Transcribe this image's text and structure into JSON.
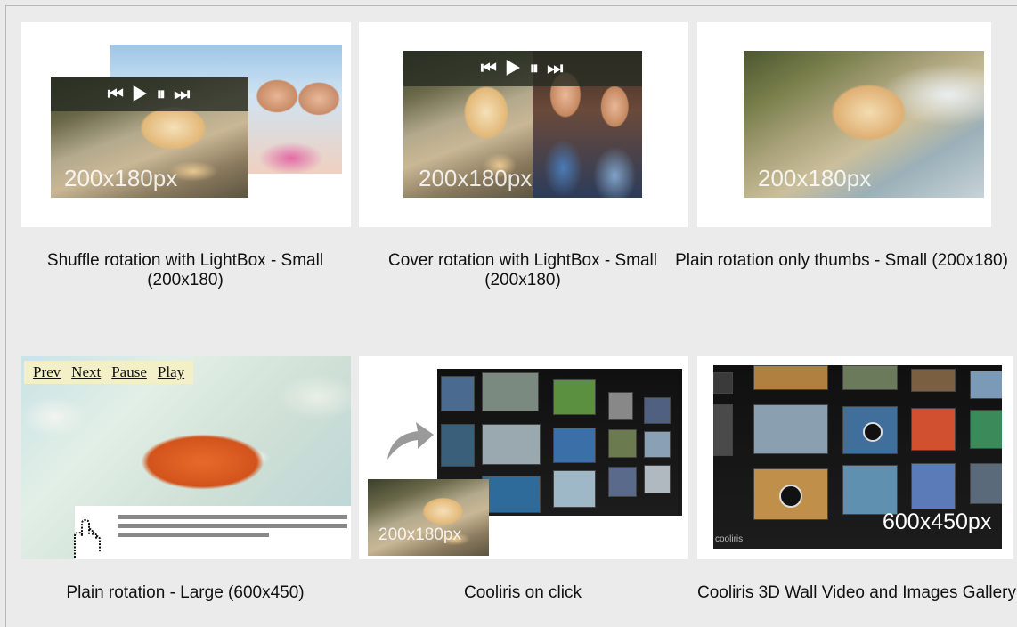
{
  "gallery": {
    "items": [
      {
        "caption": "Shuffle rotation with LightBox - Small (200x180)",
        "size_label": "200x180px",
        "controls": "⏮ ▶ ⏸ ⏭"
      },
      {
        "caption": "Cover rotation with LightBox - Small (200x180)",
        "size_label": "200x180px",
        "controls": "⏮ ▶ ⏸ ⏭"
      },
      {
        "caption": "Plain rotation only thumbs - Small (200x180)",
        "size_label": "200x180px"
      },
      {
        "caption": "Plain rotation - Large (600x450)",
        "nav": [
          "Prev",
          "Next",
          "Pause",
          "Play"
        ],
        "icon": "hand-cursor-icon"
      },
      {
        "caption": "Cooliris on click",
        "size_label": "200x180px",
        "icon": "curved-arrow-icon"
      },
      {
        "caption": "Cooliris 3D Wall Video and Images Gallery",
        "size_label": "600x450px",
        "watermark": "cooliris"
      }
    ]
  },
  "colors": {
    "background": "#ebebeb",
    "card": "#ffffff"
  }
}
